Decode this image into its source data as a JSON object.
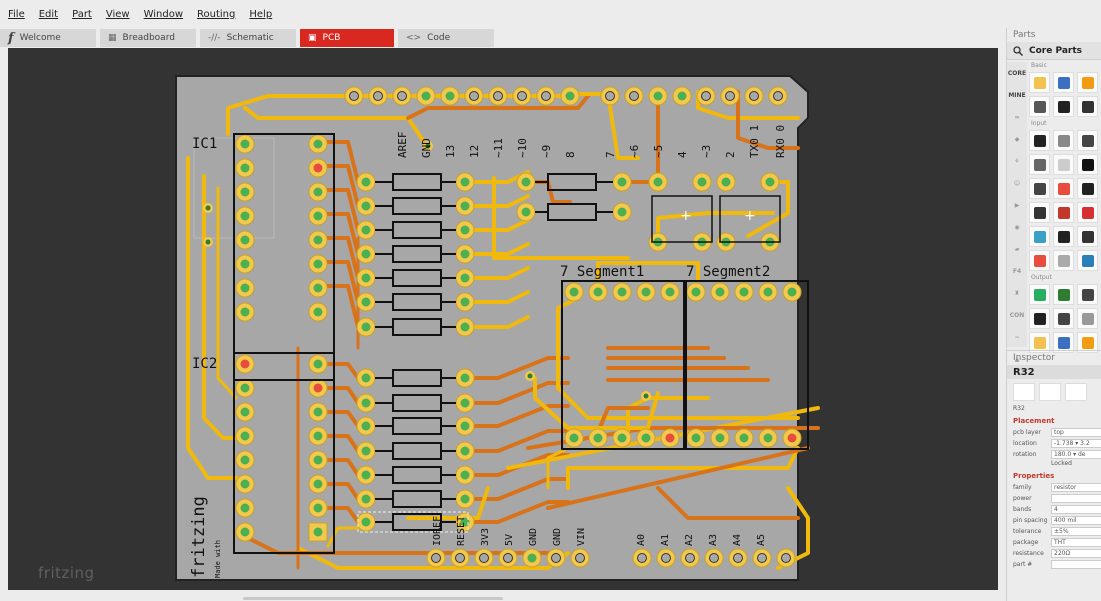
{
  "menu": [
    "File",
    "Edit",
    "Part",
    "View",
    "Window",
    "Routing",
    "Help"
  ],
  "tabs": [
    {
      "label": "Welcome",
      "icon": "f"
    },
    {
      "label": "Breadboard",
      "icon": "▦"
    },
    {
      "label": "Schematic",
      "icon": "-//-"
    },
    {
      "label": "PCB",
      "icon": "▣"
    },
    {
      "label": "Code",
      "icon": "<>"
    }
  ],
  "watermark": "fritzing",
  "pcb": {
    "ic_labels": [
      "IC1",
      "IC2"
    ],
    "segment_labels": [
      "7 Segment1",
      "7 Segment2"
    ],
    "top_header_labels": [
      "AREF",
      "GND",
      "13",
      "12",
      "~11",
      "~10",
      "~9",
      "8",
      "7",
      "~6",
      "~5",
      "4",
      "~3",
      "2",
      "TX0 1",
      "RX0 0"
    ],
    "bottom_header_labels": [
      "IOREF",
      "RESET",
      "3V3",
      "5V",
      "GND",
      "GND",
      "VIN",
      "A0",
      "A1",
      "A2",
      "A3",
      "A4",
      "A5"
    ],
    "logo_text": "fritzing",
    "logo_subtext": "Made with"
  },
  "parts": {
    "title": "Parts",
    "bin_name": "Core Parts",
    "bins": [
      "CORE",
      "MINE",
      "∞",
      "◆",
      "⚘",
      "☺",
      "▶",
      "◉",
      "▰",
      "F4",
      "♜",
      "CON",
      "~",
      "▲"
    ],
    "categories": [
      "Basic",
      "Input",
      "Output"
    ]
  },
  "inspector": {
    "title": "Inspector",
    "part_name": "R32",
    "part_sub": "R32",
    "placement_label": "Placement",
    "placement": [
      {
        "key": "pcb layer",
        "value": "top"
      },
      {
        "key": "location",
        "value": "-1.738 ▾ 3.2"
      },
      {
        "key": "rotation",
        "value": "180.0 ▾ de"
      }
    ],
    "locked": "Locked",
    "properties_label": "Properties",
    "properties": [
      {
        "key": "family",
        "value": "resistor"
      },
      {
        "key": "power",
        "value": ""
      },
      {
        "key": "bands",
        "value": "4"
      },
      {
        "key": "pin spacing",
        "value": "400 mil"
      },
      {
        "key": "tolerance",
        "value": "±5%"
      },
      {
        "key": "package",
        "value": "THT"
      },
      {
        "key": "resistance",
        "value": "220Ω"
      },
      {
        "key": "part #",
        "value": ""
      }
    ]
  },
  "colors": {
    "accent": "#d8281f",
    "board": "#a7a7a7",
    "trace_top": "#f0b90b",
    "trace_bottom": "#d8731a",
    "canvas": "#333333"
  }
}
